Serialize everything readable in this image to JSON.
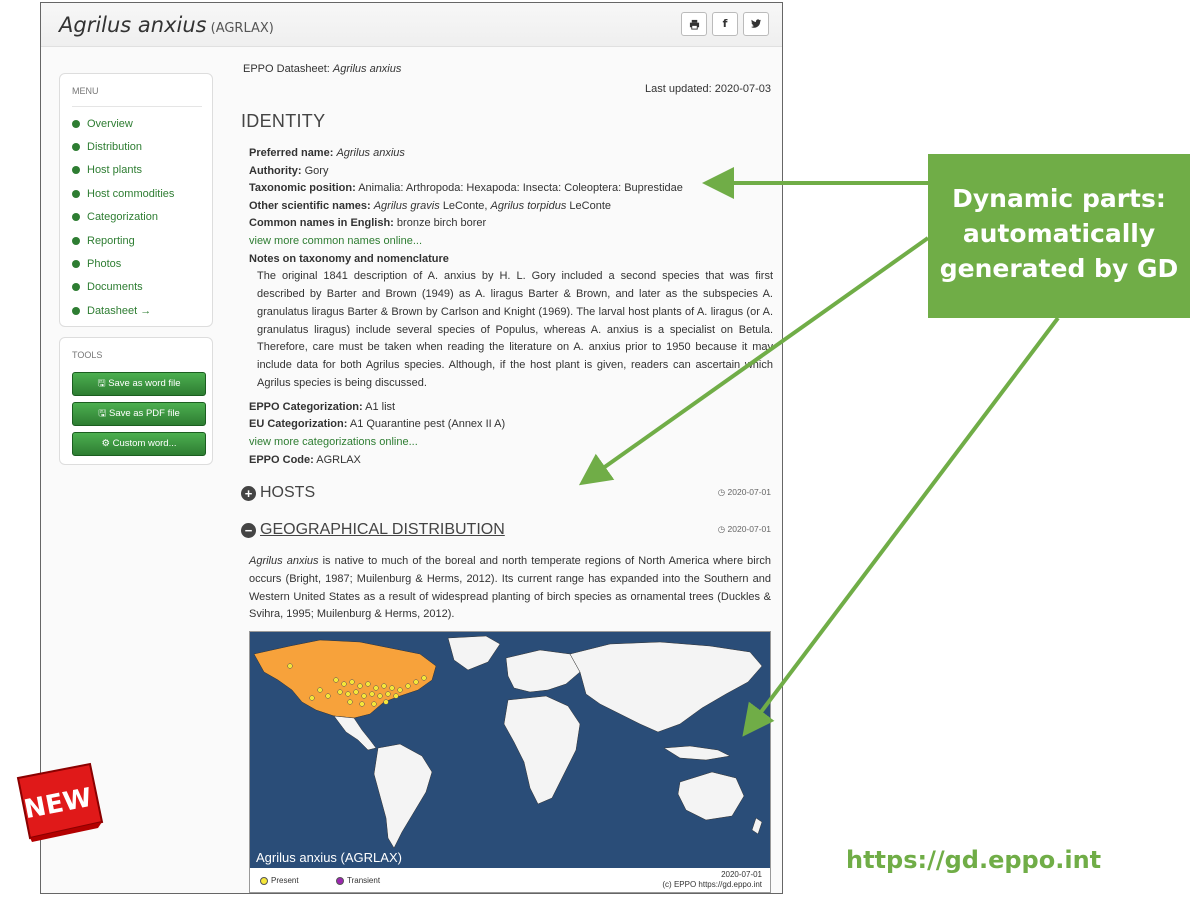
{
  "header": {
    "title": "Agrilus anxius",
    "code": "(AGRLAX)",
    "print_icon": "print-icon",
    "facebook_label": "f",
    "twitter_icon": "twitter-icon"
  },
  "menu": {
    "title": "MENU",
    "items": [
      {
        "label": "Overview"
      },
      {
        "label": "Distribution"
      },
      {
        "label": "Host plants"
      },
      {
        "label": "Host commodities"
      },
      {
        "label": "Categorization"
      },
      {
        "label": "Reporting"
      },
      {
        "label": "Photos"
      },
      {
        "label": "Documents"
      },
      {
        "label": "Datasheet →"
      }
    ]
  },
  "tools": {
    "title": "TOOLS",
    "buttons": [
      {
        "label": "Save as word file",
        "icon": "save-icon"
      },
      {
        "label": "Save as PDF file",
        "icon": "save-icon"
      },
      {
        "label": "Custom word...",
        "icon": "cogs-icon"
      }
    ]
  },
  "main": {
    "doc_label_prefix": "EPPO Datasheet: ",
    "doc_label_species": "Agrilus anxius",
    "last_updated": "Last updated: 2020-07-03",
    "identity_heading": "IDENTITY",
    "preferred_name_label": "Preferred name:",
    "preferred_name": "Agrilus anxius",
    "authority_label": "Authority:",
    "authority": "Gory",
    "taxonomic_label": "Taxonomic position:",
    "taxonomic": "Animalia: Arthropoda: Hexapoda: Insecta: Coleoptera: Buprestidae",
    "other_names_label": "Other scientific names:",
    "other_name_1": "Agrilus gravis",
    "other_name_1_author": "LeConte,",
    "other_name_2": "Agrilus torpidus",
    "other_name_2_author": "LeConte",
    "common_names_label": "Common names in English:",
    "common_names": "bronze birch borer",
    "common_names_link": "view more common names online...",
    "notes_label": "Notes on taxonomy and nomenclature",
    "notes_text": "The original 1841 description of A. anxius by H. L. Gory included a second species that was first described by Barter and Brown (1949) as A. liragus Barter & Brown, and later as the subspecies A. granulatus liragus Barter & Brown by Carlson and Knight (1969). The larval host plants of A. liragus (or A. granulatus liragus) include several species of Populus, whereas A. anxius is a specialist on Betula. Therefore, care must be taken when reading the literature on A. anxius prior to 1950 because it may include data for both Agrilus species. Although, if the host plant is given, readers can ascertain which Agrilus species is being discussed.",
    "eppo_cat_label": "EPPO Categorization:",
    "eppo_cat": "A1 list",
    "eu_cat_label": "EU Categorization:",
    "eu_cat": "A1 Quarantine pest (Annex II A)",
    "cat_link": "view more categorizations online...",
    "eppo_code_label": "EPPO Code:",
    "eppo_code": "AGRLAX",
    "hosts_heading": "HOSTS",
    "hosts_date": "◷ 2020-07-01",
    "geo_heading": "GEOGRAPHICAL DISTRIBUTION",
    "geo_date": "◷ 2020-07-01",
    "geo_species": "Agrilus anxius",
    "geo_text": " is native to much of the boreal and north temperate regions of North America where birch occurs (Bright, 1987; Muilenburg & Herms, 2012). Its current range has expanded into the Southern and Western United States as a result of widespread planting of birch species as ornamental trees (Duckles & Svihra, 1995; Muilenburg & Herms, 2012).",
    "map_caption": "Agrilus anxius (AGRLAX)",
    "map_date": "2020-07-01",
    "map_credit": "(c) EPPO https://gd.eppo.int",
    "legend_present": "Present",
    "legend_transient": "Transient",
    "colors": {
      "ocean": "#2a4d78",
      "land": "#f4f4f4",
      "present_region": "#f7a23b",
      "present_dot": "#f5e63a",
      "transient_dot": "#9c27b0",
      "green": "#2e7d32"
    }
  },
  "annotation": {
    "callout_lines": [
      "Dynamic parts:",
      "automatically",
      "generated by GD"
    ],
    "url": "https://gd.eppo.int",
    "badge": "NEW",
    "accent": "#70ad47"
  }
}
